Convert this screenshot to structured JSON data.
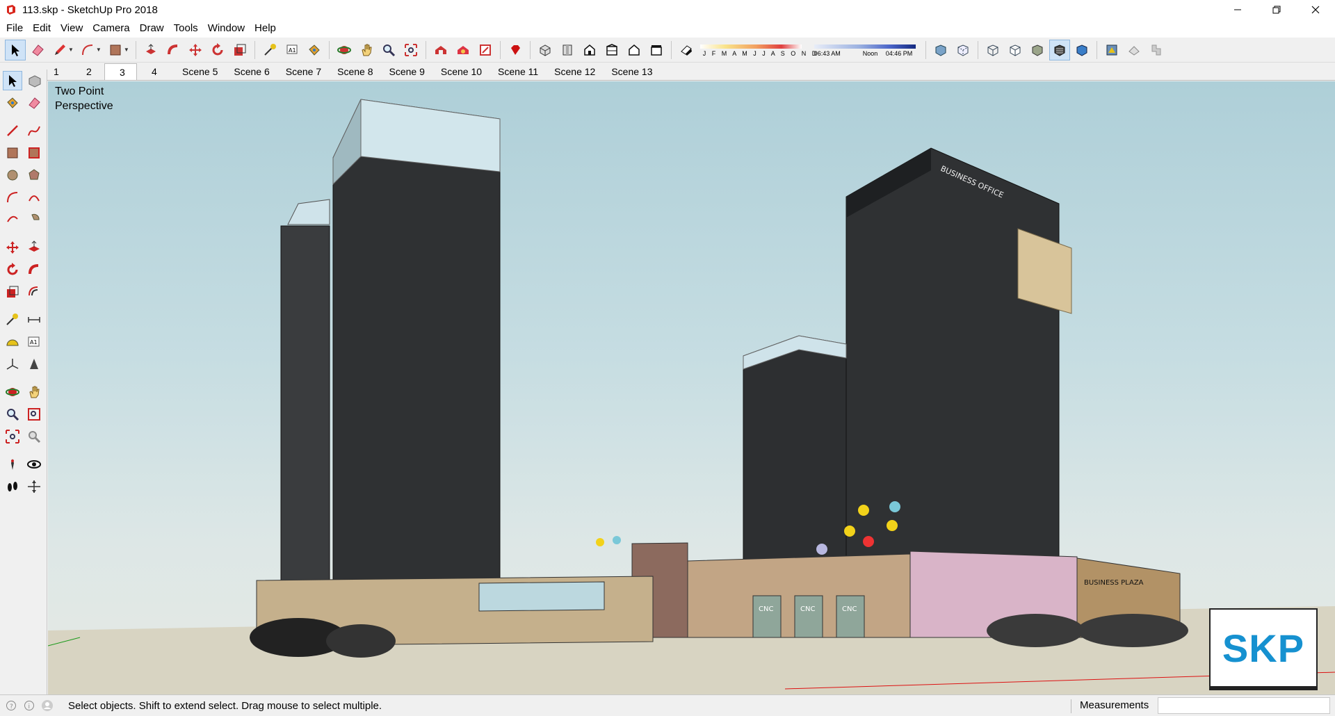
{
  "window": {
    "title": "113.skp - SketchUp Pro 2018",
    "app_icon": "sketchup-logo-icon",
    "controls": [
      "minimize-icon",
      "restore-icon",
      "close-icon"
    ]
  },
  "menu": [
    "File",
    "Edit",
    "View",
    "Camera",
    "Draw",
    "Tools",
    "Window",
    "Help"
  ],
  "toolbar": {
    "tools": [
      "select-icon",
      "eraser-icon",
      "pencil-icon",
      "arc-icon",
      "rectangle-icon",
      "push-pull-icon",
      "follow-me-icon",
      "move-icon",
      "rotate-icon",
      "scale-icon",
      "tape-measure-icon",
      "text-icon",
      "paint-bucket-icon",
      "orbit-icon",
      "pan-icon",
      "zoom-icon",
      "zoom-extents-icon",
      "warehouse-icon",
      "extension-warehouse-icon",
      "layout-icon",
      "ruby-icon",
      "iso-view-icon",
      "top-view-icon",
      "front-view-icon",
      "right-view-icon",
      "back-view-icon",
      "left-view-icon",
      "shadows-icon",
      "xray-icon",
      "back-edges-icon",
      "wireframe-icon",
      "hidden-line-icon",
      "shaded-icon",
      "shaded-textures-icon",
      "monochrome-icon",
      "section-plane-icon",
      "section-display-icon",
      "section-cut-icon"
    ],
    "shadow_months": "J F M A M J J A S O N D",
    "time_start": "06:43 AM",
    "time_mid": "Noon",
    "time_end": "04:46 PM"
  },
  "scenes": {
    "tabs": [
      "1",
      "2",
      "3",
      "4",
      "Scene 5",
      "Scene 6",
      "Scene 7",
      "Scene 8",
      "Scene 9",
      "Scene 10",
      "Scene 11",
      "Scene 12",
      "Scene 13"
    ],
    "active": "3"
  },
  "palette": {
    "tools": [
      [
        "select-icon",
        "component-icon"
      ],
      [
        "paint-bucket-icon",
        "eraser-icon"
      ],
      [
        "line-icon",
        "freehand-icon"
      ],
      [
        "rectangle-icon",
        "rotated-rectangle-icon"
      ],
      [
        "circle-icon",
        "polygon-icon"
      ],
      [
        "arc-icon",
        "two-point-arc-icon"
      ],
      [
        "three-point-arc-icon",
        "pie-icon"
      ],
      [
        "move-icon",
        "push-pull-icon"
      ],
      [
        "rotate-icon",
        "follow-me-icon"
      ],
      [
        "scale-icon",
        "offset-icon"
      ],
      [
        "tape-measure-icon",
        "dimension-icon"
      ],
      [
        "protractor-icon",
        "text-icon"
      ],
      [
        "axes-icon",
        "3d-text-icon"
      ],
      [
        "orbit-icon",
        "pan-icon"
      ],
      [
        "zoom-icon",
        "zoom-window-icon"
      ],
      [
        "zoom-extents-icon",
        "previous-view-icon"
      ],
      [
        "position-camera-icon",
        "look-around-icon"
      ],
      [
        "walk-icon",
        "section-plane-icon"
      ]
    ]
  },
  "viewport": {
    "camera_line1": "Two Point",
    "camera_line2": "Perspective",
    "sky_color": "#aecfd8",
    "ground_color": "#d8d4c2"
  },
  "signage": {
    "tower_sign": "BUSINESS OFFICE",
    "plaza_sign": "BUSINESS PLAZA",
    "kiosk_label": "CNC",
    "logo_text": "SKP"
  },
  "statusbar": {
    "icons": [
      "geo-location-icon",
      "credits-icon",
      "user-icon"
    ],
    "message": "Select objects. Shift to extend select. Drag mouse to select multiple.",
    "measurements_label": "Measurements",
    "measurements_value": ""
  }
}
